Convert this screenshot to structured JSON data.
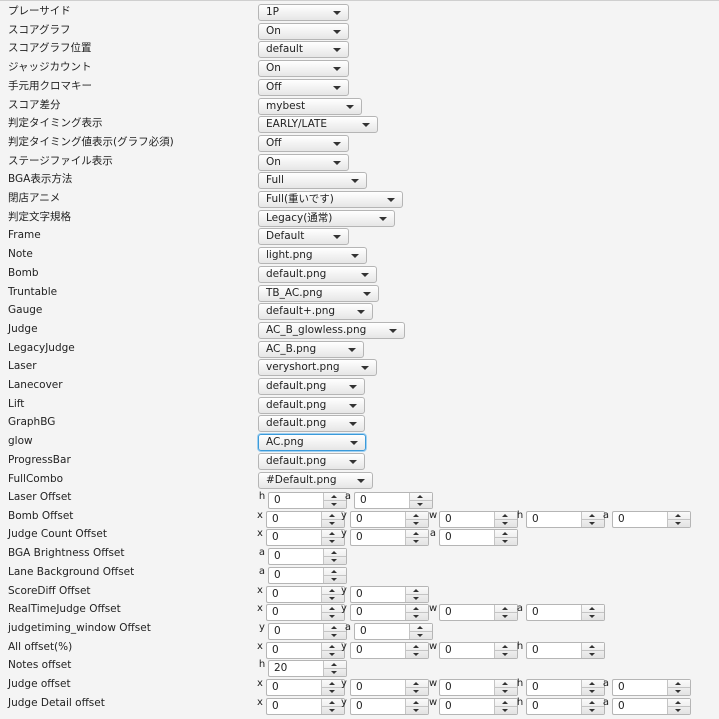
{
  "combos": [
    {
      "label": "プレーサイド",
      "value": "1P"
    },
    {
      "label": "スコアグラフ",
      "value": "On"
    },
    {
      "label": "スコアグラフ位置",
      "value": "default"
    },
    {
      "label": "ジャッジカウント",
      "value": "On"
    },
    {
      "label": "手元用クロマキー",
      "value": "Off"
    },
    {
      "label": "スコア差分",
      "value": "mybest"
    },
    {
      "label": "判定タイミング表示",
      "value": "EARLY/LATE"
    },
    {
      "label": "判定タイミング値表示(グラフ必須)",
      "value": "Off"
    },
    {
      "label": "ステージファイル表示",
      "value": "On"
    },
    {
      "label": "BGA表示方法",
      "value": "Full"
    },
    {
      "label": "閉店アニメ",
      "value": "Full(重いです)"
    },
    {
      "label": "判定文字規格",
      "value": "Legacy(通常)"
    },
    {
      "label": "Frame",
      "value": "Default"
    },
    {
      "label": "Note",
      "value": "light.png"
    },
    {
      "label": "Bomb",
      "value": "default.png"
    },
    {
      "label": "Truntable",
      "value": "TB_AC.png"
    },
    {
      "label": "Gauge",
      "value": "default+.png"
    },
    {
      "label": "Judge",
      "value": "AC_B_glowless.png"
    },
    {
      "label": "LegacyJudge",
      "value": "AC_B.png"
    },
    {
      "label": "Laser",
      "value": "veryshort.png"
    },
    {
      "label": "Lanecover",
      "value": "default.png"
    },
    {
      "label": "Lift",
      "value": "default.png"
    },
    {
      "label": "GraphBG",
      "value": "default.png"
    },
    {
      "label": "glow",
      "value": "AC.png"
    },
    {
      "label": "ProgressBar",
      "value": "default.png"
    },
    {
      "label": "FullCombo",
      "value": "#Default.png"
    }
  ],
  "offsets": [
    {
      "label": "Laser Offset",
      "fields": [
        {
          "k": "h",
          "v": "0"
        },
        {
          "k": "a",
          "v": "0"
        }
      ]
    },
    {
      "label": "Bomb Offset",
      "fields": [
        {
          "k": "x",
          "v": "0"
        },
        {
          "k": "y",
          "v": "0"
        },
        {
          "k": "w",
          "v": "0"
        },
        {
          "k": "h",
          "v": "0"
        },
        {
          "k": "a",
          "v": "0"
        }
      ]
    },
    {
      "label": "Judge Count Offset",
      "fields": [
        {
          "k": "x",
          "v": "0"
        },
        {
          "k": "y",
          "v": "0"
        },
        {
          "k": "a",
          "v": "0"
        }
      ]
    },
    {
      "label": "BGA Brightness Offset",
      "fields": [
        {
          "k": "a",
          "v": "0"
        }
      ]
    },
    {
      "label": "Lane Background Offset",
      "fields": [
        {
          "k": "a",
          "v": "0"
        }
      ]
    },
    {
      "label": "ScoreDiff Offset",
      "fields": [
        {
          "k": "x",
          "v": "0"
        },
        {
          "k": "y",
          "v": "0"
        }
      ]
    },
    {
      "label": "RealTimeJudge Offset",
      "fields": [
        {
          "k": "x",
          "v": "0"
        },
        {
          "k": "y",
          "v": "0"
        },
        {
          "k": "w",
          "v": "0"
        },
        {
          "k": "a",
          "v": "0"
        }
      ]
    },
    {
      "label": "judgetiming_window Offset",
      "fields": [
        {
          "k": "y",
          "v": "0"
        },
        {
          "k": "a",
          "v": "0"
        }
      ]
    },
    {
      "label": "All offset(%)",
      "fields": [
        {
          "k": "x",
          "v": "0"
        },
        {
          "k": "y",
          "v": "0"
        },
        {
          "k": "w",
          "v": "0"
        },
        {
          "k": "h",
          "v": "0"
        }
      ]
    },
    {
      "label": "Notes offset",
      "fields": [
        {
          "k": "h",
          "v": "20"
        }
      ]
    },
    {
      "label": "Judge offset",
      "fields": [
        {
          "k": "x",
          "v": "0"
        },
        {
          "k": "y",
          "v": "0"
        },
        {
          "k": "w",
          "v": "0"
        },
        {
          "k": "h",
          "v": "0"
        },
        {
          "k": "a",
          "v": "0"
        }
      ]
    },
    {
      "label": "Judge Detail offset",
      "fields": [
        {
          "k": "x",
          "v": "0"
        },
        {
          "k": "y",
          "v": "0"
        },
        {
          "k": "w",
          "v": "0"
        },
        {
          "k": "h",
          "v": "0"
        },
        {
          "k": "a",
          "v": "0"
        }
      ]
    }
  ]
}
